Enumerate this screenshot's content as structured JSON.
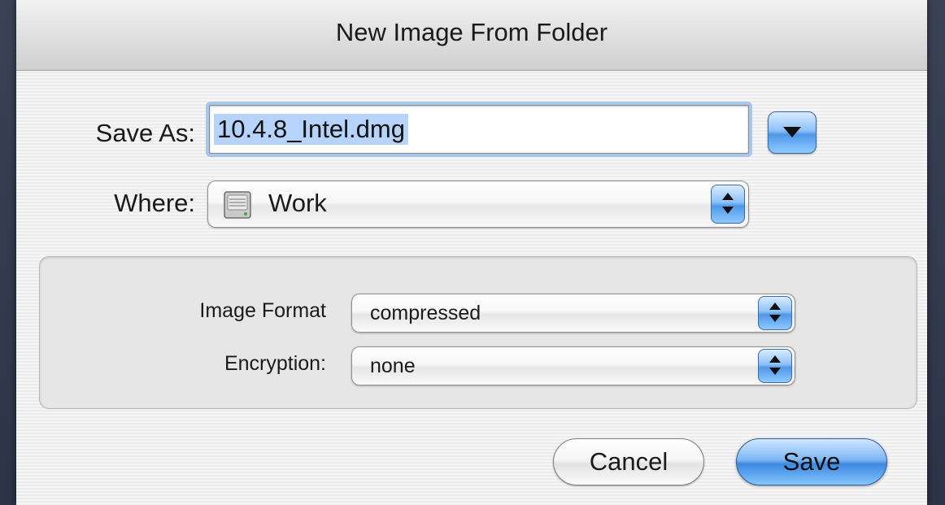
{
  "dialog": {
    "title": "New Image From Folder"
  },
  "save_as": {
    "label": "Save As:",
    "value": "10.4.8_Intel.dmg",
    "menu_icon": "disclosure-triangle-icon"
  },
  "where": {
    "label": "Where:",
    "selected": "Work",
    "icon": "hard-drive-icon"
  },
  "options": {
    "image_format_label": "Image Format",
    "image_format_value": "compressed",
    "encryption_label": "Encryption:",
    "encryption_value": "none"
  },
  "buttons": {
    "cancel": "Cancel",
    "save": "Save"
  },
  "colors": {
    "accent_blue": "#4f98e6",
    "selection": "#b5d3fb",
    "focus_ring": "#a9c6ef"
  }
}
